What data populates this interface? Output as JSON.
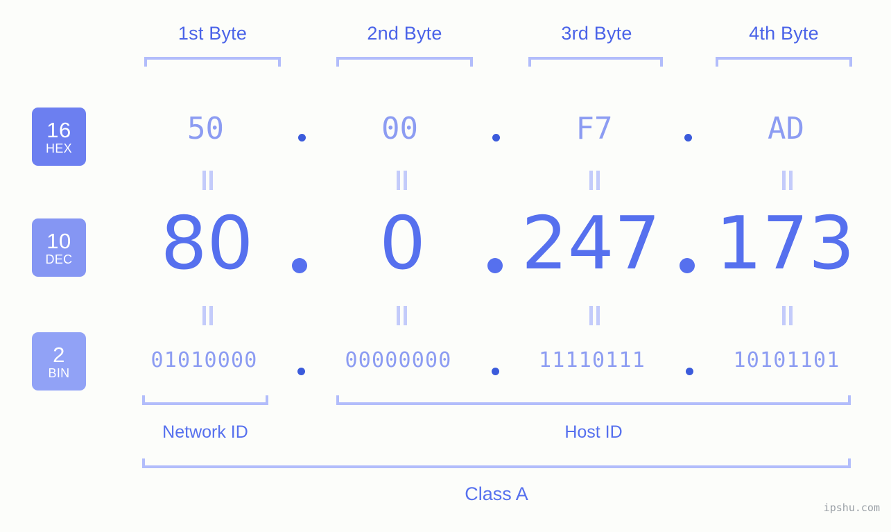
{
  "meta": {
    "watermark": "ipshu.com"
  },
  "byte_headers": [
    {
      "label": "1st Byte"
    },
    {
      "label": "2nd Byte"
    },
    {
      "label": "3rd Byte"
    },
    {
      "label": "4th Byte"
    }
  ],
  "bases": [
    {
      "number": "16",
      "name": "HEX",
      "color": "#6c7ff0"
    },
    {
      "number": "10",
      "name": "DEC",
      "color": "#8596f3"
    },
    {
      "number": "2",
      "name": "BIN",
      "color": "#91a2f6"
    }
  ],
  "rows": {
    "hex": {
      "base_number": "16",
      "base_name": "HEX",
      "values": [
        "50",
        "00",
        "F7",
        "AD"
      ],
      "separator": "."
    },
    "dec": {
      "base_number": "10",
      "base_name": "DEC",
      "values": [
        "80",
        "0",
        "247",
        "173"
      ],
      "separator": "."
    },
    "bin": {
      "base_number": "2",
      "base_name": "BIN",
      "values": [
        "01010000",
        "00000000",
        "11110111",
        "10101101"
      ],
      "separator": "."
    }
  },
  "equals_symbol": "=",
  "sections": {
    "network_id": "Network ID",
    "host_id": "Host ID",
    "class": "Class A"
  },
  "colors": {
    "background": "#fcfdfa",
    "bracket": "#b2bdfb",
    "byte_label": "#4a63e8",
    "hex_text": "#8c9cf2",
    "dec_text": "#5670ee",
    "bin_text": "#8c9cf2",
    "dot": "#3b5bdb",
    "watermark": "#9aa0a6"
  }
}
